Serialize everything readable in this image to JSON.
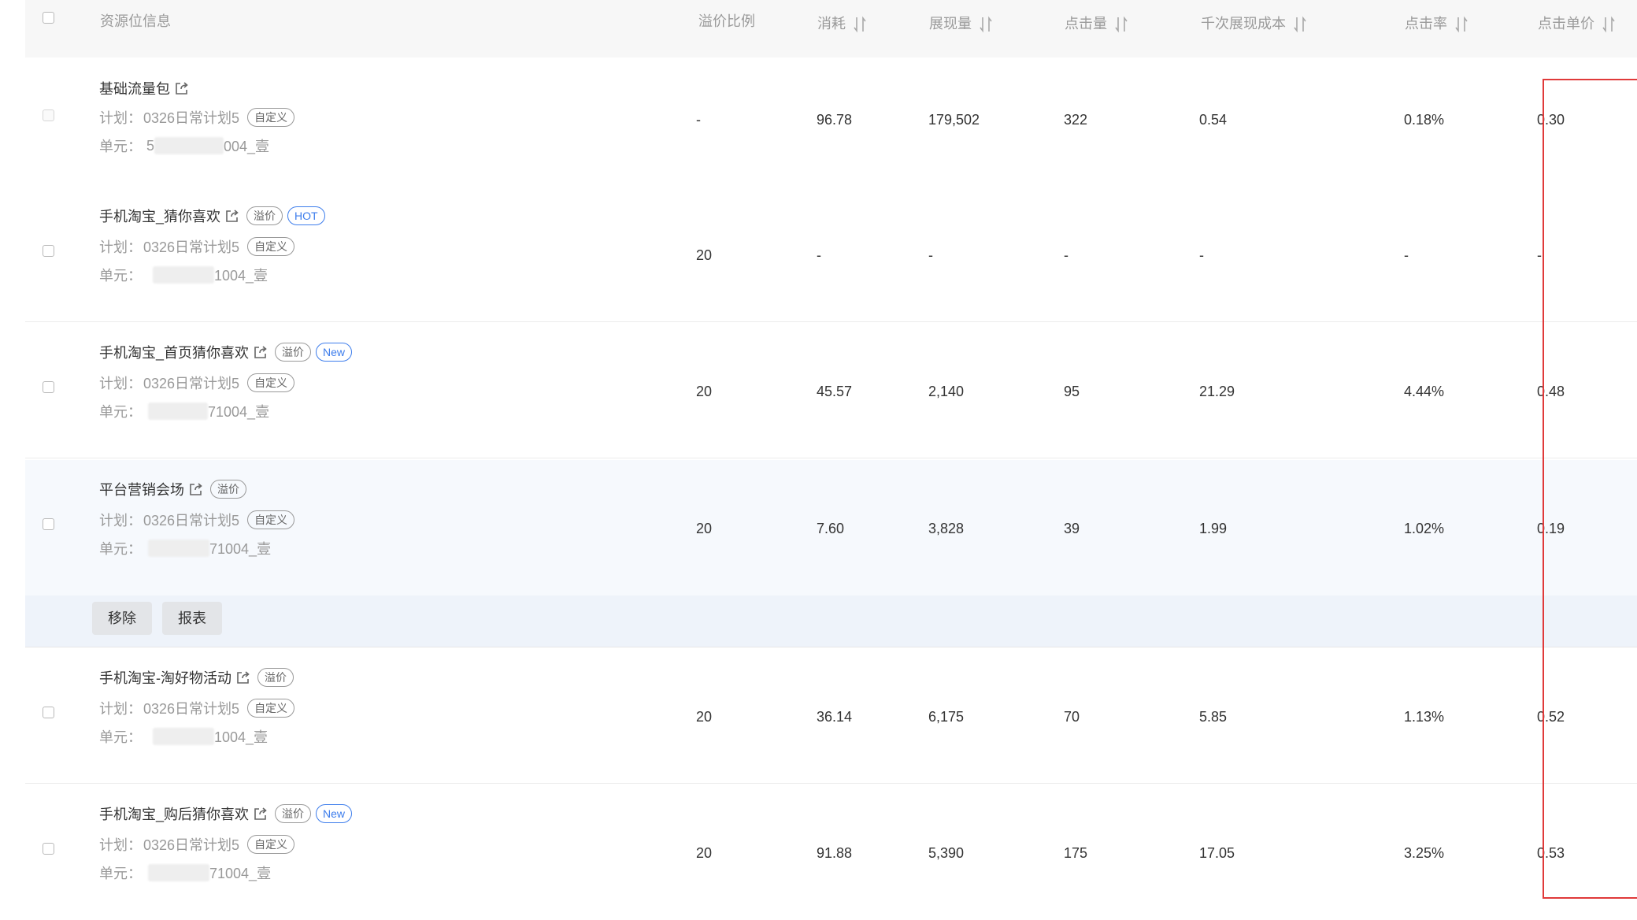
{
  "header": {
    "resource_info": "资源位信息",
    "premium_ratio": "溢价比例",
    "cost": "消耗",
    "impressions": "展现量",
    "clicks": "点击量",
    "cpm": "千次展现成本",
    "ctr": "点击率",
    "cpc": "点击单价"
  },
  "labels": {
    "plan_prefix": "计划：",
    "unit_prefix": "单元：",
    "custom_tag": "自定义",
    "premium_tag": "溢价"
  },
  "rows": [
    {
      "name": "基础流量包",
      "tags": [],
      "plan": "0326日常计划5",
      "unit_lead": "5",
      "unit_tail": "004_壹",
      "premium": "-",
      "cost": "96.78",
      "impressions": "179,502",
      "clicks": "322",
      "cpm": "0.54",
      "ctr": "0.18%",
      "cpc": "0.30"
    },
    {
      "name": "手机淘宝_猜你喜欢",
      "tags": [
        "溢价",
        "HOT"
      ],
      "plan": "0326日常计划5",
      "unit_lead": "",
      "unit_tail": "1004_壹",
      "premium": "20",
      "cost": "-",
      "impressions": "-",
      "clicks": "-",
      "cpm": "-",
      "ctr": "-",
      "cpc": "-"
    },
    {
      "name": "手机淘宝_首页猜你喜欢",
      "tags": [
        "溢价",
        "New"
      ],
      "plan": "0326日常计划5",
      "unit_lead": "",
      "unit_tail": "71004_壹",
      "premium": "20",
      "cost": "45.57",
      "impressions": "2,140",
      "clicks": "95",
      "cpm": "21.29",
      "ctr": "4.44%",
      "cpc": "0.48"
    },
    {
      "name": "平台营销会场",
      "tags": [
        "溢价"
      ],
      "plan": "0326日常计划5",
      "unit_lead": "",
      "unit_tail": "71004_壹",
      "premium": "20",
      "cost": "7.60",
      "impressions": "3,828",
      "clicks": "39",
      "cpm": "1.99",
      "ctr": "1.02%",
      "cpc": "0.19"
    },
    {
      "name": "手机淘宝-淘好物活动",
      "tags": [
        "溢价"
      ],
      "plan": "0326日常计划5",
      "unit_lead": "",
      "unit_tail": "1004_壹",
      "premium": "20",
      "cost": "36.14",
      "impressions": "6,175",
      "clicks": "70",
      "cpm": "5.85",
      "ctr": "1.13%",
      "cpc": "0.52"
    },
    {
      "name": "手机淘宝_购后猜你喜欢",
      "tags": [
        "溢价",
        "New"
      ],
      "plan": "0326日常计划5",
      "unit_lead": "",
      "unit_tail": "71004_壹",
      "premium": "20",
      "cost": "91.88",
      "impressions": "5,390",
      "clicks": "175",
      "cpm": "17.05",
      "ctr": "3.25%",
      "cpc": "0.53"
    }
  ],
  "actions": {
    "remove": "移除",
    "report": "报表"
  },
  "colors": {
    "highlight_box": "#e03a3a",
    "tag_blue": "#3d7dec",
    "header_bg": "#f7f7f7",
    "selected_row_bg": "#f6f9fd"
  }
}
